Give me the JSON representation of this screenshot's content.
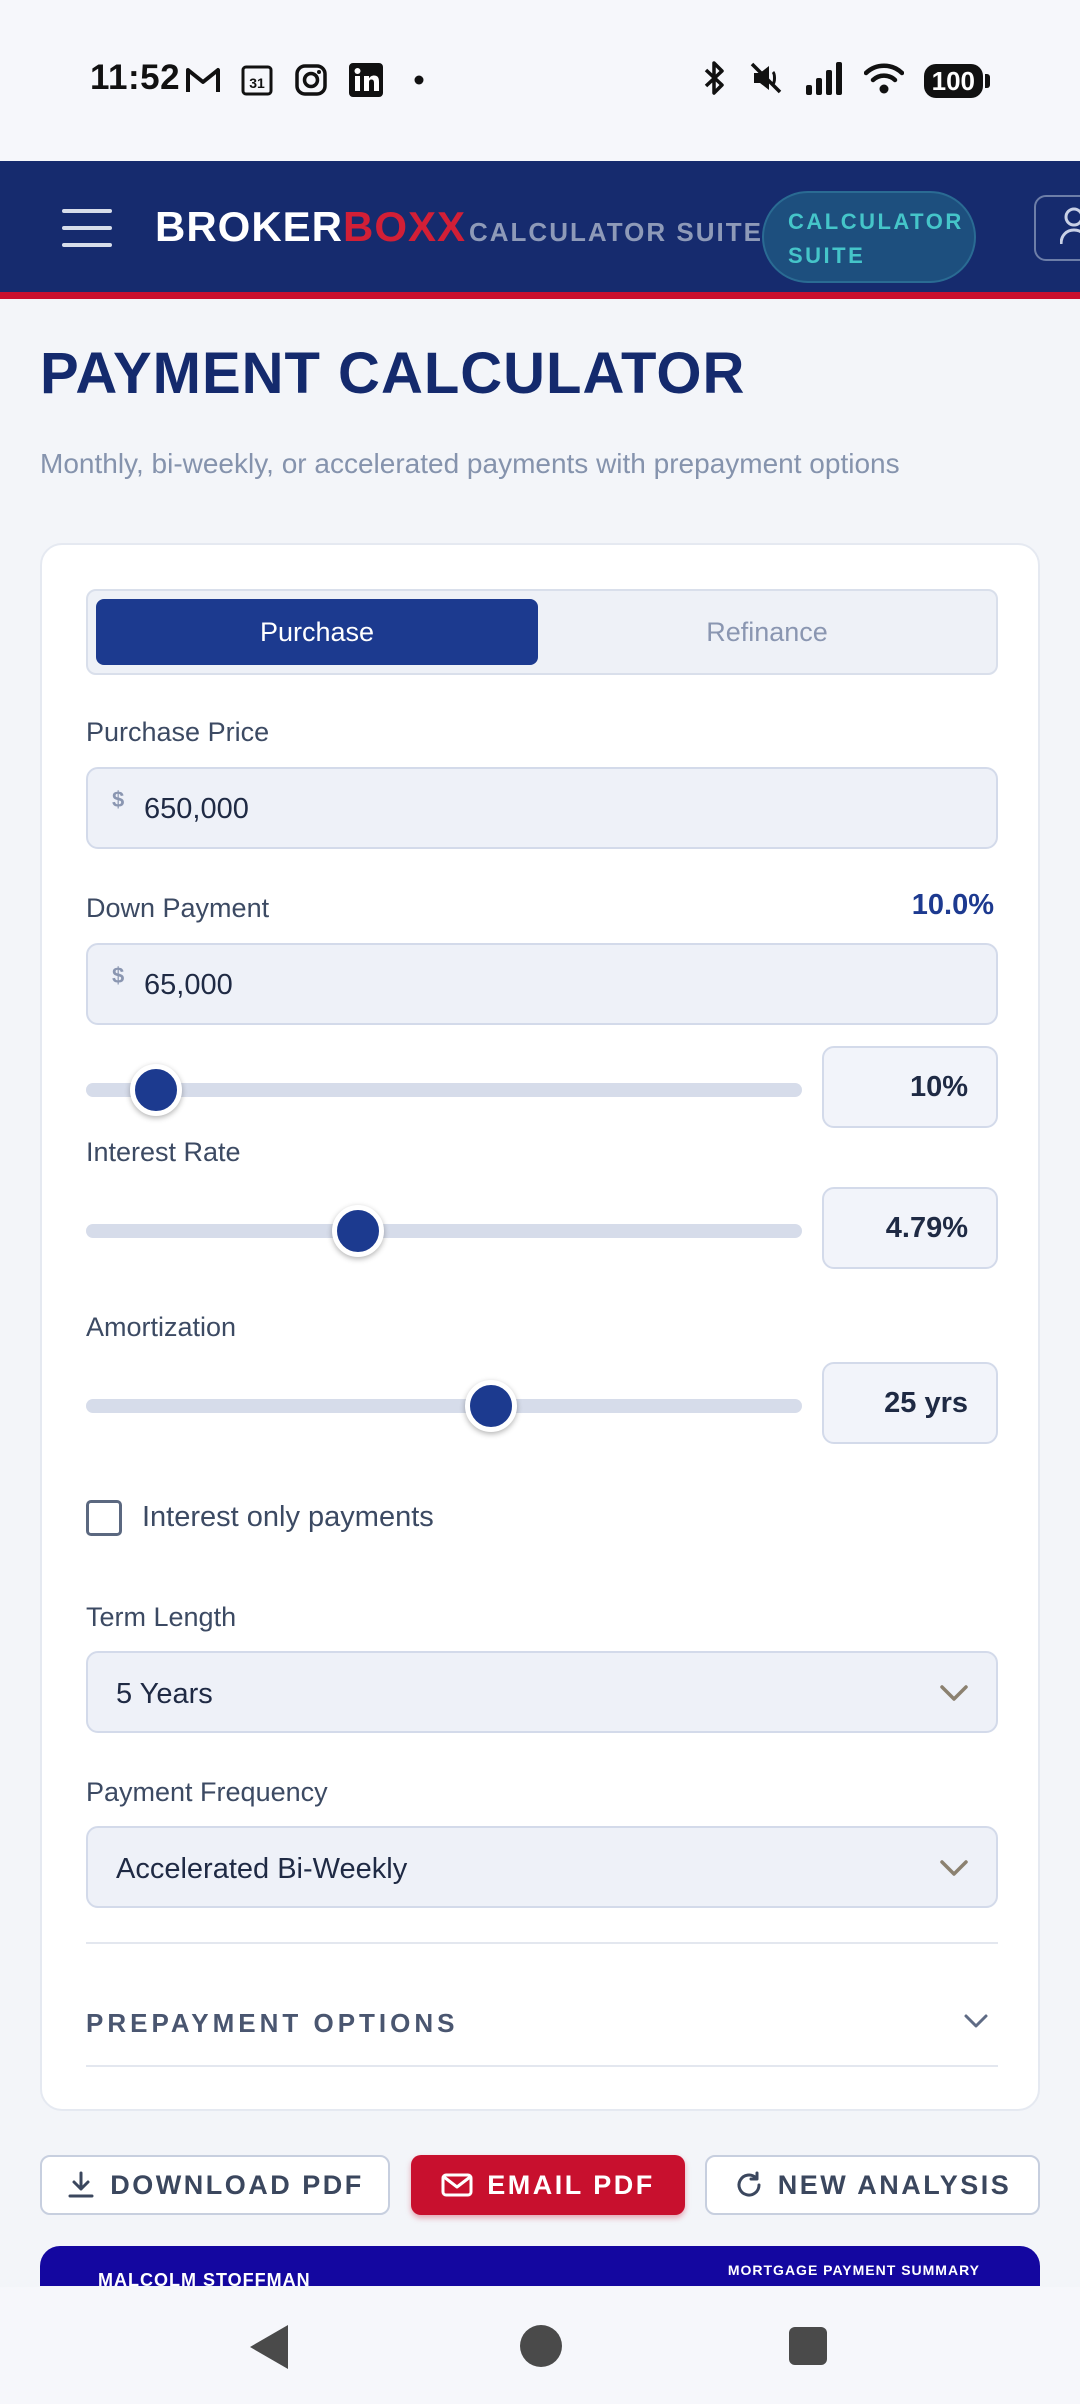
{
  "status_bar": {
    "time": "11:52",
    "left_icons": [
      "gmail-icon",
      "calendar-icon",
      "instagram-icon",
      "linkedin-icon",
      "dot-icon"
    ],
    "calendar_day": "31",
    "battery": "100",
    "right_icons": [
      "bluetooth-icon",
      "mute-icon",
      "signal-icon",
      "wifi-icon",
      "battery-icon"
    ]
  },
  "header": {
    "brand_part1": "BROKER",
    "brand_part2": "BOXX",
    "brand_subtitle": "CALCULATOR SUITE",
    "pill_line1": "CALCULATOR",
    "pill_line2": "SUITE",
    "brand_color": "#162b6e",
    "accent_color": "#c8102e"
  },
  "page": {
    "title": "PAYMENT CALCULATOR",
    "subtitle": "Monthly, bi-weekly, or accelerated payments with prepayment options"
  },
  "form": {
    "tabs": [
      {
        "label": "Purchase",
        "active": true
      },
      {
        "label": "Refinance",
        "active": false
      }
    ],
    "purchase_price": {
      "label": "Purchase Price",
      "currency": "$",
      "value": "650,000"
    },
    "down_payment": {
      "label": "Down Payment",
      "percent_display": "10.0%",
      "currency": "$",
      "value": "65,000",
      "slider_value": "10%",
      "slider_fraction": 0.1
    },
    "interest_rate": {
      "label": "Interest Rate",
      "slider_value": "4.79%",
      "slider_fraction": 0.38
    },
    "amortization": {
      "label": "Amortization",
      "slider_value": "25 yrs",
      "slider_fraction": 0.57
    },
    "interest_only": {
      "label": "Interest only payments",
      "checked": false
    },
    "term_length": {
      "label": "Term Length",
      "value": "5 Years"
    },
    "payment_frequency": {
      "label": "Payment Frequency",
      "value": "Accelerated Bi-Weekly"
    },
    "prepayment": {
      "label": "PREPAYMENT OPTIONS"
    }
  },
  "actions": {
    "download": "DOWNLOAD PDF",
    "email": "EMAIL PDF",
    "new": "NEW ANALYSIS"
  },
  "summary": {
    "name": "MALCOLM STOFFMAN",
    "title": "MORTGAGE PAYMENT SUMMARY"
  }
}
